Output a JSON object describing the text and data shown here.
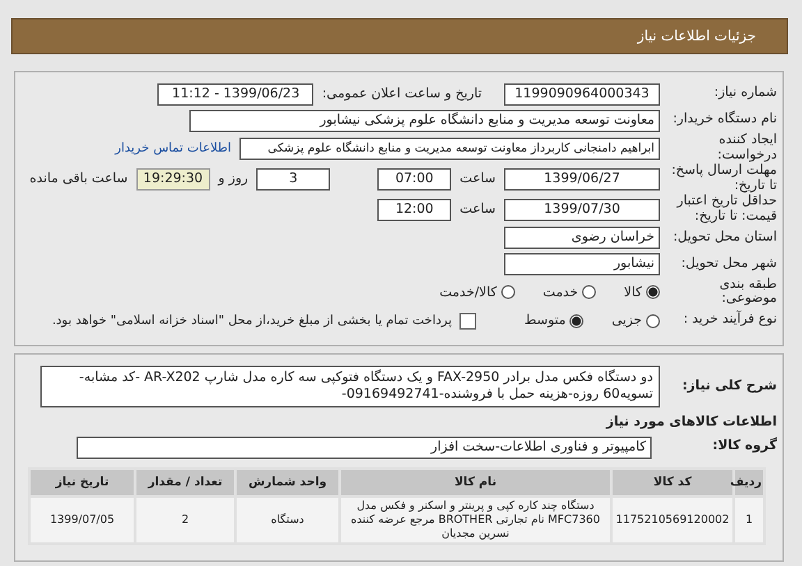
{
  "header": {
    "title": "جزئیات اطلاعات نیاز"
  },
  "need_number": {
    "label": "شماره نیاز:",
    "value": "1199090964000343"
  },
  "announce": {
    "label": "تاریخ و ساعت اعلان عمومی:",
    "value": "1399/06/23 - 11:12"
  },
  "buyer": {
    "label": "نام دستگاه خریدار:",
    "value": "معاونت توسعه مدیریت و منابع دانشگاه علوم پزشکی نیشابور"
  },
  "requester": {
    "label": "ایجاد کننده درخواست:",
    "value": "ابراهیم دامنجانی  کاربرداز معاونت توسعه مدیریت و منابع دانشگاه علوم پزشکی",
    "link": "اطلاعات تماس خریدار"
  },
  "deadline": {
    "label": "مهلت ارسال پاسخ: تا تاریخ:",
    "date": "1399/06/27",
    "time_label": "ساعت",
    "time": "07:00",
    "days": "3",
    "days_label": "روز و",
    "remaining": "19:29:30",
    "remaining_label": "ساعت باقی مانده"
  },
  "validity": {
    "label": "حداقل تاریخ اعتبار قیمت: تا تاریخ:",
    "date": "1399/07/30",
    "time_label": "ساعت",
    "time": "12:00"
  },
  "province": {
    "label": "استان محل تحویل:",
    "value": "خراسان رضوی"
  },
  "city": {
    "label": "شهر محل تحویل:",
    "value": "نیشابور"
  },
  "category": {
    "label": "طبقه بندی موضوعی:",
    "options": [
      {
        "label": "کالا",
        "selected": true
      },
      {
        "label": "خدمت",
        "selected": false
      },
      {
        "label": "کالا/خدمت",
        "selected": false
      }
    ]
  },
  "process": {
    "label": "نوع فرآیند خرید :",
    "options": [
      {
        "label": "جزیی",
        "selected": false
      },
      {
        "label": "متوسط",
        "selected": true
      }
    ],
    "payment": {
      "checked": false,
      "text": "پرداخت تمام یا بخشی از مبلغ خرید،از محل \"اسناد خزانه اسلامی\" خواهد بود."
    }
  },
  "description": {
    "label": "شرح کلی نیاز:",
    "value": "دو دستگاه فکس مدل  برادر FAX-2950  و یک دستگاه فتوکپی سه کاره مدل شارپ AR-X202 -کد مشابه-تسویه60 روزه-هزینه حمل با فروشنده-09169492741-"
  },
  "goods": {
    "title": "اطلاعات کالاهای مورد نیاز",
    "group_label": "گروه کالا:",
    "group": "کامپیوتر و فناوری اطلاعات-سخت افزار",
    "table": {
      "columns": [
        "ردیف",
        "کد کالا",
        "نام کالا",
        "واحد شمارش",
        "تعداد / مقدار",
        "تاریخ نیاز"
      ],
      "rows": [
        [
          "1",
          "1175210569120002",
          "دستگاه چند کاره کپی و پرینتر و اسکنر و فکس مدل MFC7360 نام تجارتی BROTHER مرجع عرضه کننده نسرین مجدیان",
          "دستگاه",
          "2",
          "1399/07/05"
        ]
      ]
    }
  }
}
